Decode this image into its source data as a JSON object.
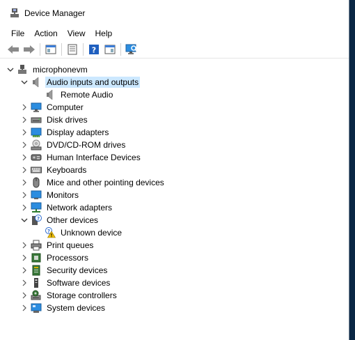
{
  "window": {
    "title": "Device Manager"
  },
  "menu": [
    "File",
    "Action",
    "View",
    "Help"
  ],
  "toolbar": {
    "buttons": [
      "back-icon",
      "forward-icon",
      "show-hide-console-tree-icon",
      "properties-icon",
      "help-icon",
      "view-resources-icon",
      "scan-hardware-icon"
    ]
  },
  "tree": {
    "root": "microphonevm",
    "nodes": [
      {
        "label": "Audio inputs and outputs",
        "icon": "speaker-icon",
        "expanded": true,
        "selected": true,
        "children": [
          {
            "label": "Remote Audio",
            "icon": "speaker-icon"
          }
        ]
      },
      {
        "label": "Computer",
        "icon": "computer-icon"
      },
      {
        "label": "Disk drives",
        "icon": "disk-drive-icon"
      },
      {
        "label": "Display adapters",
        "icon": "display-adapter-icon"
      },
      {
        "label": "DVD/CD-ROM drives",
        "icon": "dvd-drive-icon"
      },
      {
        "label": "Human Interface Devices",
        "icon": "hid-icon"
      },
      {
        "label": "Keyboards",
        "icon": "keyboard-icon"
      },
      {
        "label": "Mice and other pointing devices",
        "icon": "mouse-icon"
      },
      {
        "label": "Monitors",
        "icon": "monitor-icon"
      },
      {
        "label": "Network adapters",
        "icon": "network-adapter-icon"
      },
      {
        "label": "Other devices",
        "icon": "other-devices-icon",
        "expanded": true,
        "children": [
          {
            "label": "Unknown device",
            "icon": "unknown-device-warning-icon"
          }
        ]
      },
      {
        "label": "Print queues",
        "icon": "printer-icon"
      },
      {
        "label": "Processors",
        "icon": "processor-icon"
      },
      {
        "label": "Security devices",
        "icon": "security-device-icon"
      },
      {
        "label": "Software devices",
        "icon": "software-device-icon"
      },
      {
        "label": "Storage controllers",
        "icon": "storage-controller-icon"
      },
      {
        "label": "System devices",
        "icon": "system-devices-icon"
      }
    ]
  },
  "colors": {
    "selection": "#cce8ff",
    "desktop": "#0a2744"
  }
}
